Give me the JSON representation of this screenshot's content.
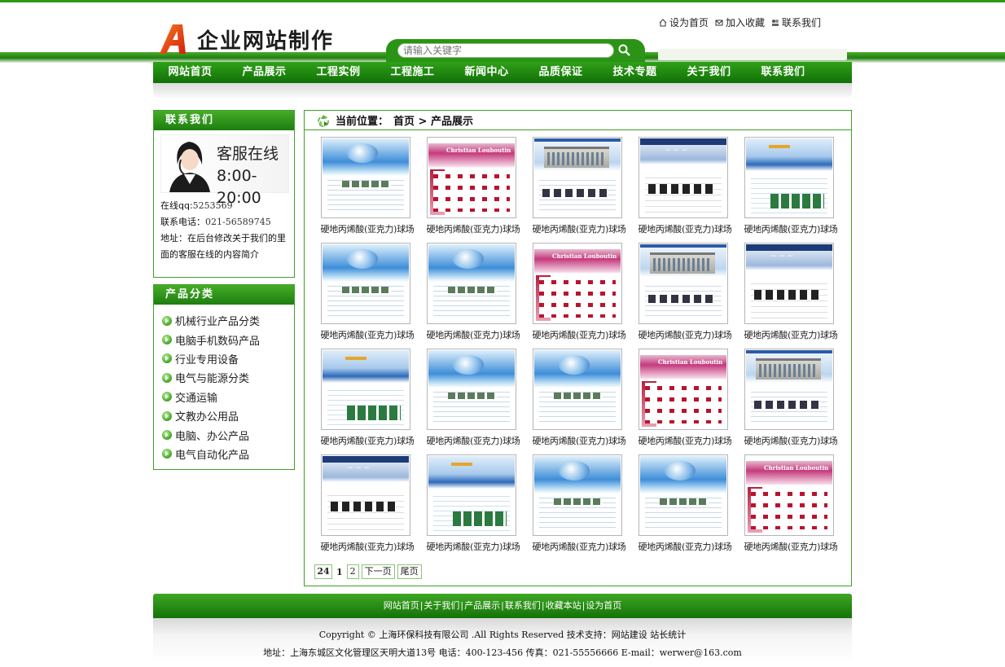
{
  "site": {
    "logo_letter": "A",
    "logo_text": "企业网站制作"
  },
  "top_links": [
    {
      "icon": "home-icon",
      "label": "设为首页"
    },
    {
      "icon": "favorite-icon",
      "label": "加入收藏"
    },
    {
      "icon": "contact-icon",
      "label": "联系我们"
    }
  ],
  "search": {
    "placeholder": "请输入关键字",
    "value": "请输入关键字"
  },
  "nav": [
    "网站首页",
    "产品展示",
    "工程实例",
    "工程施工",
    "新闻中心",
    "品质保证",
    "技术专题",
    "关于我们",
    "联系我们"
  ],
  "contact": {
    "title": "联系我们",
    "service_line1": "客服在线",
    "service_line2": "8:00-20:00",
    "qq_label": "在线qq:",
    "qq_value": "5253569",
    "phone_label": "联系电话：",
    "phone_value": "021-56589745",
    "address": "地址：在后台修改关于我们的里面的客服在线的内容简介"
  },
  "categories": {
    "title": "产品分类",
    "items": [
      "机械行业产品分类",
      "电脑手机数码产品",
      "行业专用设备",
      "电气与能源分类",
      "交通运输",
      "文教办公用品",
      "电脑、办公产品",
      "电气自动化产品"
    ]
  },
  "breadcrumb": {
    "label": "当前位置：",
    "path": "首页 > 产品展示"
  },
  "products": [
    {
      "style": "blue",
      "caption": "硬地丙烯酸(亚克力)球场"
    },
    {
      "style": "pink",
      "caption": "硬地丙烯酸(亚克力)球场"
    },
    {
      "style": "build",
      "caption": "硬地丙烯酸(亚克力)球场"
    },
    {
      "style": "dark",
      "caption": "硬地丙烯酸(亚克力)球场"
    },
    {
      "style": "sky",
      "caption": "硬地丙烯酸(亚克力)球场"
    },
    {
      "style": "blue",
      "caption": "硬地丙烯酸(亚克力)球场"
    },
    {
      "style": "blue",
      "caption": "硬地丙烯酸(亚克力)球场"
    },
    {
      "style": "pink",
      "caption": "硬地丙烯酸(亚克力)球场"
    },
    {
      "style": "build",
      "caption": "硬地丙烯酸(亚克力)球场"
    },
    {
      "style": "dark",
      "caption": "硬地丙烯酸(亚克力)球场"
    },
    {
      "style": "sky",
      "caption": "硬地丙烯酸(亚克力)球场"
    },
    {
      "style": "blue",
      "caption": "硬地丙烯酸(亚克力)球场"
    },
    {
      "style": "blue",
      "caption": "硬地丙烯酸(亚克力)球场"
    },
    {
      "style": "pink",
      "caption": "硬地丙烯酸(亚克力)球场"
    },
    {
      "style": "build",
      "caption": "硬地丙烯酸(亚克力)球场"
    },
    {
      "style": "dark",
      "caption": "硬地丙烯酸(亚克力)球场"
    },
    {
      "style": "sky",
      "caption": "硬地丙烯酸(亚克力)球场"
    },
    {
      "style": "blue",
      "caption": "硬地丙烯酸(亚克力)球场"
    },
    {
      "style": "blue",
      "caption": "硬地丙烯酸(亚克力)球场"
    },
    {
      "style": "pink",
      "caption": "硬地丙烯酸(亚克力)球场"
    }
  ],
  "pager": {
    "total": "24",
    "current": "1",
    "page2": "2",
    "next": "下一页",
    "last": "尾页"
  },
  "footer": {
    "links": [
      "网站首页",
      "关于我们",
      "产品展示",
      "联系我们",
      "收藏本站",
      "设为首页"
    ],
    "copyright": "Copyright © 上海环保科技有限公司 .All Rights Reserved 技术支持：网站建设 站长统计",
    "address": "地址：上海东城区文化管理区天明大道13号 电话：400-123-456 传真：021-55556666 E-mail：werwer@163.com"
  },
  "colors": {
    "brand_green": "#2e9a16",
    "dark_green": "#127007",
    "logo_red": "#e03a1a"
  }
}
